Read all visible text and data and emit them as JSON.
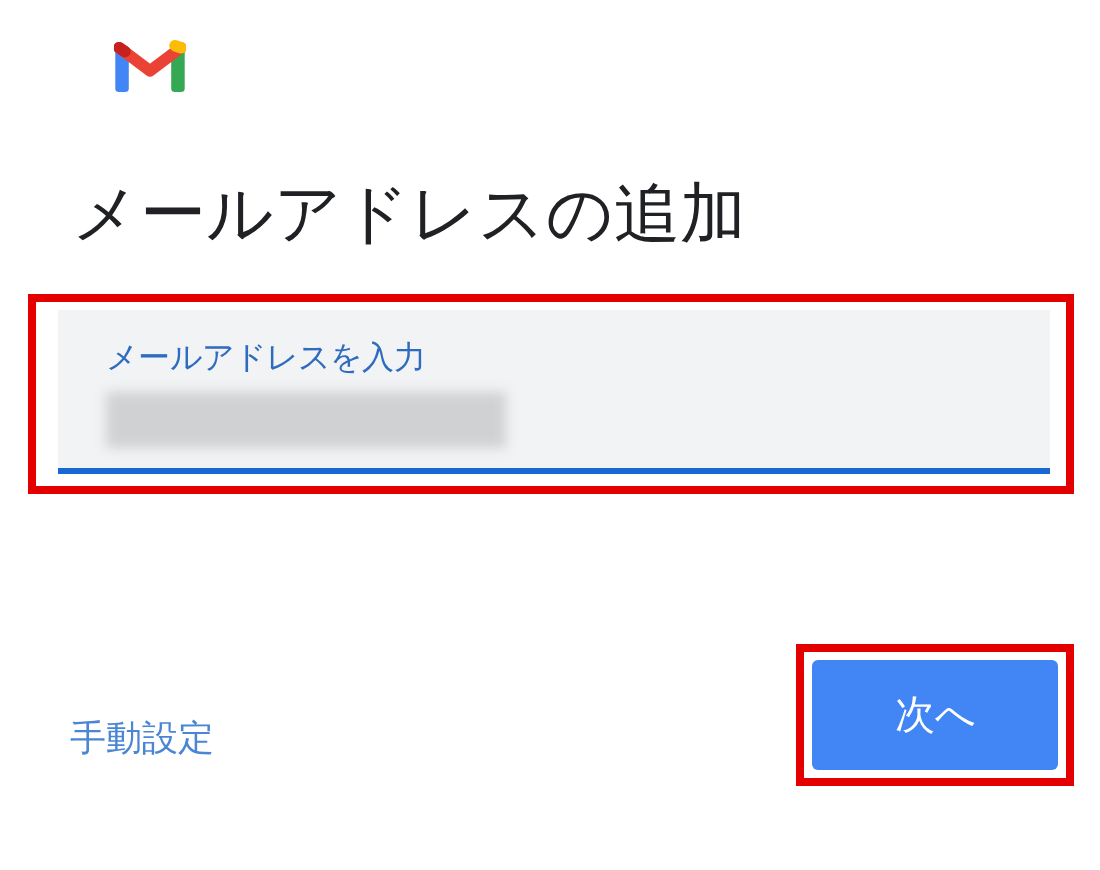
{
  "title": "メールアドレスの追加",
  "email_field": {
    "label": "メールアドレスを入力",
    "highlighted": true
  },
  "manual_link": "手動設定",
  "next_button": {
    "label": "次へ",
    "highlighted": true
  }
}
